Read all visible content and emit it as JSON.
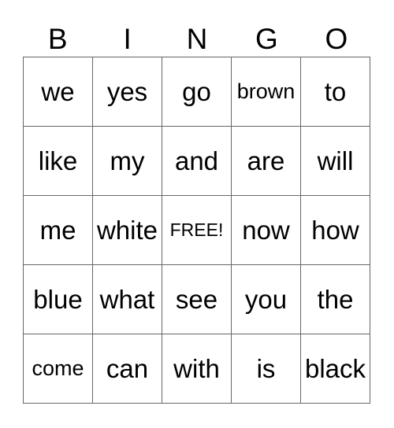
{
  "header": [
    "B",
    "I",
    "N",
    "G",
    "O"
  ],
  "rows": [
    [
      "we",
      "yes",
      "go",
      "brown",
      "to"
    ],
    [
      "like",
      "my",
      "and",
      "are",
      "will"
    ],
    [
      "me",
      "white",
      "FREE!",
      "now",
      "how"
    ],
    [
      "blue",
      "what",
      "see",
      "you",
      "the"
    ],
    [
      "come",
      "can",
      "with",
      "is",
      "black"
    ]
  ]
}
